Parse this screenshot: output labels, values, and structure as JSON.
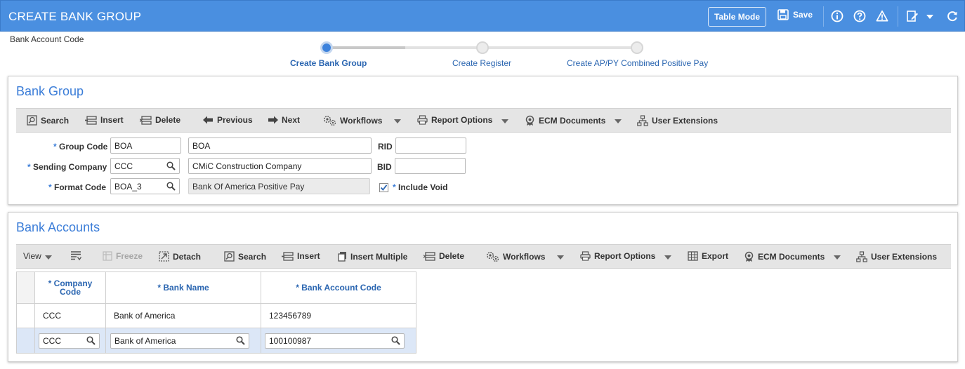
{
  "header": {
    "title": "CREATE BANK GROUP",
    "table_mode_label": "Table Mode",
    "save_label": "Save"
  },
  "page_label": "Bank Account Code",
  "wizard": {
    "steps": [
      {
        "label": "Create Bank Group",
        "state": "active"
      },
      {
        "label": "Create Register",
        "state": "pending"
      },
      {
        "label": "Create AP/PY Combined Positive Pay",
        "state": "pending"
      }
    ]
  },
  "bank_group": {
    "title": "Bank Group",
    "toolbar": {
      "search": "Search",
      "insert": "Insert",
      "delete": "Delete",
      "previous": "Previous",
      "next": "Next",
      "workflows": "Workflows",
      "report_options": "Report Options",
      "ecm_documents": "ECM Documents",
      "user_extensions": "User Extensions"
    },
    "form": {
      "group_code": {
        "label": "Group Code",
        "value": "BOA",
        "description": "BOA"
      },
      "sending_company": {
        "label": "Sending Company",
        "value": "CCC",
        "description": "CMiC Construction Company"
      },
      "format_code": {
        "label": "Format Code",
        "value": "BOA_3",
        "description": "Bank Of America Positive Pay"
      },
      "rid": {
        "label": "RID",
        "value": ""
      },
      "bid": {
        "label": "BID",
        "value": ""
      },
      "include_void": {
        "label": "Include Void",
        "checked": true
      }
    },
    "required_marker": "*"
  },
  "bank_accounts": {
    "title": "Bank Accounts",
    "toolbar": {
      "view": "View",
      "freeze": "Freeze",
      "detach": "Detach",
      "search": "Search",
      "insert": "Insert",
      "insert_multiple": "Insert Multiple",
      "delete": "Delete",
      "workflows": "Workflows",
      "report_options": "Report Options",
      "export": "Export",
      "ecm_documents": "ECM Documents",
      "user_extensions": "User Extensions"
    },
    "columns": {
      "company_code_line1": "* Company",
      "company_code_line2": "Code",
      "bank_name": "* Bank Name",
      "bank_account_code": "* Bank Account Code"
    },
    "rows": [
      {
        "company_code": "CCC",
        "bank_name": "Bank of America",
        "bank_account_code": "123456789"
      },
      {
        "company_code": "CCC",
        "bank_name": "Bank of America",
        "bank_account_code": "100100987"
      }
    ]
  },
  "colors": {
    "header_bg": "#4a8fe0",
    "accent": "#3b7dd8",
    "link": "#2b66b1",
    "toolbar_bg": "#e5e5e5",
    "selected_row": "#dce7f7"
  },
  "icons": [
    "save-icon",
    "info-icon",
    "help-icon",
    "warning-icon",
    "edit-icon",
    "refresh-icon",
    "search-icon",
    "insert-icon",
    "delete-icon",
    "previous-arrow-icon",
    "next-arrow-icon",
    "workflows-icon",
    "printer-icon",
    "ecm-icon",
    "user-extensions-icon",
    "column-chooser-icon",
    "freeze-icon",
    "detach-icon",
    "export-icon",
    "insert-multiple-icon",
    "magnifier-icon"
  ]
}
